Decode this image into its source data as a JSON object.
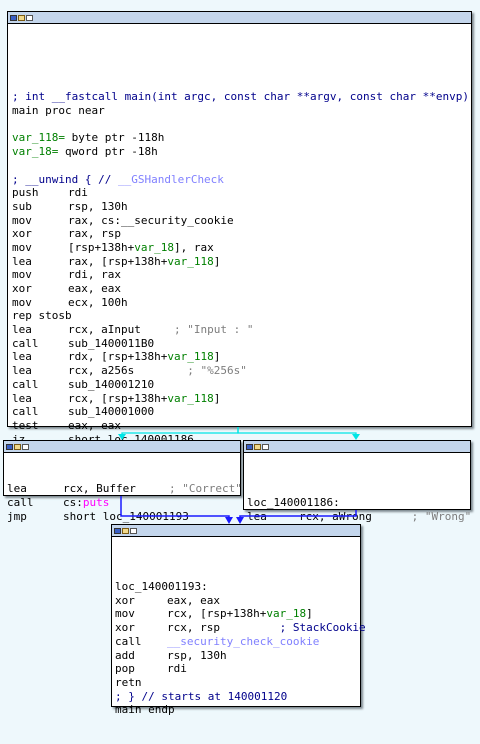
{
  "main_block": {
    "lines": [
      {
        "t": "; int __fastcall main(int argc, const char **argv, const char **envp)",
        "cls": "c-cmt"
      },
      {
        "t": "main proc near",
        "cls": ""
      },
      {
        "t": "",
        "cls": "blank"
      },
      {
        "m": "var_118=",
        "o": " byte ptr -118h",
        "mcls": "c-var"
      },
      {
        "m": "var_18=",
        "o": " qword ptr -18h",
        "mcls": "c-var"
      },
      {
        "t": "",
        "cls": "blank"
      },
      {
        "t": "; __unwind { // __GSHandlerCheck",
        "cls": "c-cmt"
      },
      {
        "m": "push",
        "o": "rdi"
      },
      {
        "m": "sub",
        "o": "rsp, 130h"
      },
      {
        "m": "mov",
        "o": "rax, cs:__security_cookie"
      },
      {
        "m": "xor",
        "o": "rax, rsp"
      },
      {
        "m": "mov",
        "o": "[rsp+138h+var_18], rax"
      },
      {
        "m": "lea",
        "o": "rax, [rsp+138h+var_118]"
      },
      {
        "m": "mov",
        "o": "rdi, rax"
      },
      {
        "m": "xor",
        "o": "eax, eax"
      },
      {
        "m": "mov",
        "o": "ecx, 100h"
      },
      {
        "t": "rep stosb",
        "cls": ""
      },
      {
        "m": "lea",
        "o": "rcx, aInput",
        "c": "     ; \"Input : \""
      },
      {
        "m": "call",
        "o": "sub_1400011B0"
      },
      {
        "m": "lea",
        "o": "rdx, [rsp+138h+var_118]"
      },
      {
        "m": "lea",
        "o": "rcx, a256s",
        "c": "        ; \"%256s\""
      },
      {
        "m": "call",
        "o": "sub_140001210"
      },
      {
        "m": "lea",
        "o": "rcx, [rsp+138h+var_118]"
      },
      {
        "m": "call",
        "o": "sub_140001000"
      },
      {
        "m": "test",
        "o": "eax, eax"
      },
      {
        "m": "jz",
        "o": "short loc_140001186"
      }
    ]
  },
  "left_block": {
    "lines": [
      {
        "m": "lea",
        "o": "rcx, Buffer",
        "c": "     ; \"Correct\""
      },
      {
        "m": "call",
        "o": "cs:puts"
      },
      {
        "m": "jmp",
        "o": "short loc_140001193"
      }
    ]
  },
  "right_block": {
    "lines": [
      {
        "t": "",
        "cls": "blank"
      },
      {
        "t": "loc_140001186:",
        "cls": ""
      },
      {
        "m": "lea",
        "o": "rcx, aWrong",
        "c": "      ; \"Wrong\""
      },
      {
        "m": "call",
        "o": "cs:puts"
      }
    ]
  },
  "bottom_block": {
    "lines": [
      {
        "t": "",
        "cls": "blank"
      },
      {
        "t": "loc_140001193:",
        "cls": ""
      },
      {
        "m": "xor",
        "o": "eax, eax"
      },
      {
        "m": "mov",
        "o": "rcx, [rsp+138h+var_18]"
      },
      {
        "m": "xor",
        "o": "rcx, rsp",
        "c": "         ; StackCookie"
      },
      {
        "m": "call",
        "o": "__security_check_cookie"
      },
      {
        "m": "add",
        "o": "rsp, 130h"
      },
      {
        "m": "pop",
        "o": "rdi"
      },
      {
        "t": "retn",
        "cls": ""
      },
      {
        "t": "; } // starts at 140001120",
        "cls": "c-cmt"
      },
      {
        "t": "main endp",
        "cls": ""
      }
    ]
  },
  "colors": {
    "true_edge": "#00e5e5",
    "false_edge": "#00e5e5",
    "jump_edge": "#0000ff"
  }
}
